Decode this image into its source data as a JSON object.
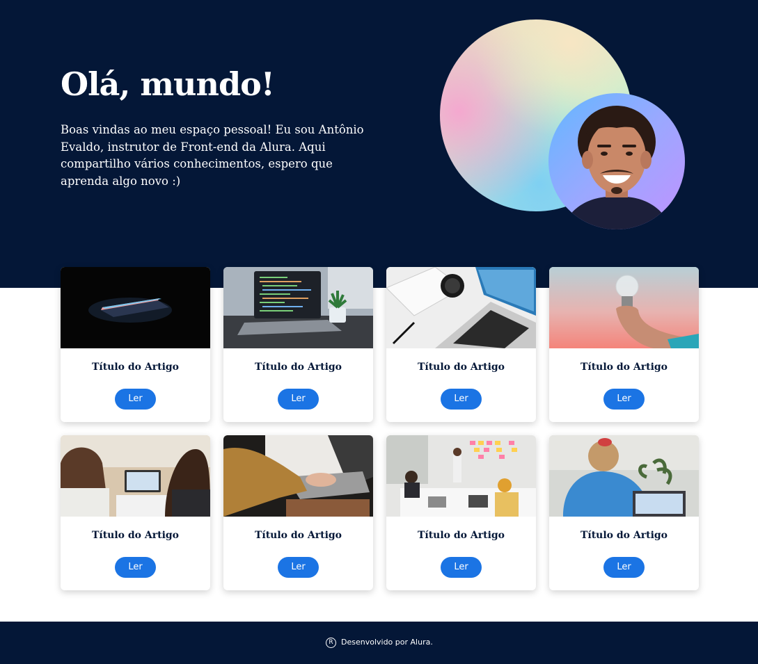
{
  "hero": {
    "title": "Olá, mundo!",
    "text": "Boas vindas ao meu espaço pessoal! Eu sou Antônio Evaldo, instrutor de Front-end da Alura. Aqui compartilho vários conhecimentos, espero que aprenda algo novo :)"
  },
  "articles": [
    {
      "title": "Título do Artigo",
      "button": "Ler"
    },
    {
      "title": "Título do Artigo",
      "button": "Ler"
    },
    {
      "title": "Título do Artigo",
      "button": "Ler"
    },
    {
      "title": "Título do Artigo",
      "button": "Ler"
    },
    {
      "title": "Título do Artigo",
      "button": "Ler"
    },
    {
      "title": "Título do Artigo",
      "button": "Ler"
    },
    {
      "title": "Título do Artigo",
      "button": "Ler"
    },
    {
      "title": "Título do Artigo",
      "button": "Ler"
    }
  ],
  "footer": {
    "icon_glyph": "R",
    "text": "Desenvolvido por Alura."
  },
  "colors": {
    "navy": "#041737",
    "button_blue": "#1b74e4",
    "white": "#ffffff"
  }
}
